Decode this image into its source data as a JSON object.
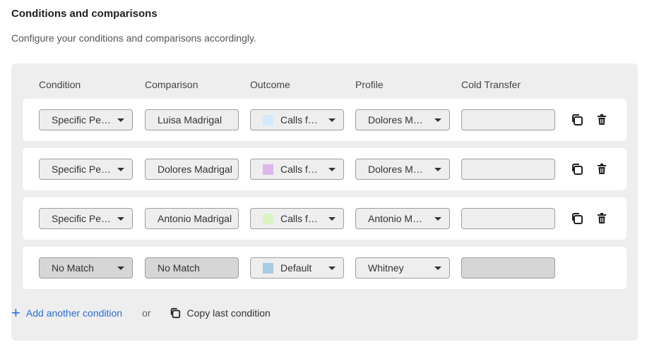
{
  "page": {
    "title": "Conditions and comparisons",
    "subtitle": "Configure your conditions and comparisons accordingly."
  },
  "headers": {
    "condition": "Condition",
    "comparison": "Comparison",
    "outcome": "Outcome",
    "profile": "Profile",
    "cold_transfer": "Cold Transfer"
  },
  "rows": [
    {
      "condition": "Specific Person",
      "comparison": "Luisa Madrigal",
      "outcome": "Calls for Luisa",
      "outcome_color": "#d4e9fb",
      "profile": "Dolores Madrigal",
      "cold_transfer": ""
    },
    {
      "condition": "Specific Person",
      "comparison": "Dolores Madrigal",
      "outcome": "Calls for Dolores",
      "outcome_color": "#dcb7ea",
      "profile": "Dolores Madrigal",
      "cold_transfer": ""
    },
    {
      "condition": "Specific Person",
      "comparison": "Antonio Madrigal",
      "outcome": "Calls for Antonio",
      "outcome_color": "#dcf3c4",
      "profile": "Antonio Madrigal",
      "cold_transfer": ""
    },
    {
      "condition": "No Match",
      "comparison": "No Match",
      "outcome": "Default",
      "outcome_color": "#a9cbe3",
      "profile": "Whitney",
      "cold_transfer": ""
    }
  ],
  "footer": {
    "add_label": "Add another condition",
    "or_label": "or",
    "copy_label": "Copy last condition"
  },
  "icons": {
    "row_actions": [
      "copy-icon",
      "trash-icon"
    ],
    "add": "plus-icon"
  },
  "colors": {
    "accent": "#2a6dd6",
    "panel": "#eeeeee"
  }
}
